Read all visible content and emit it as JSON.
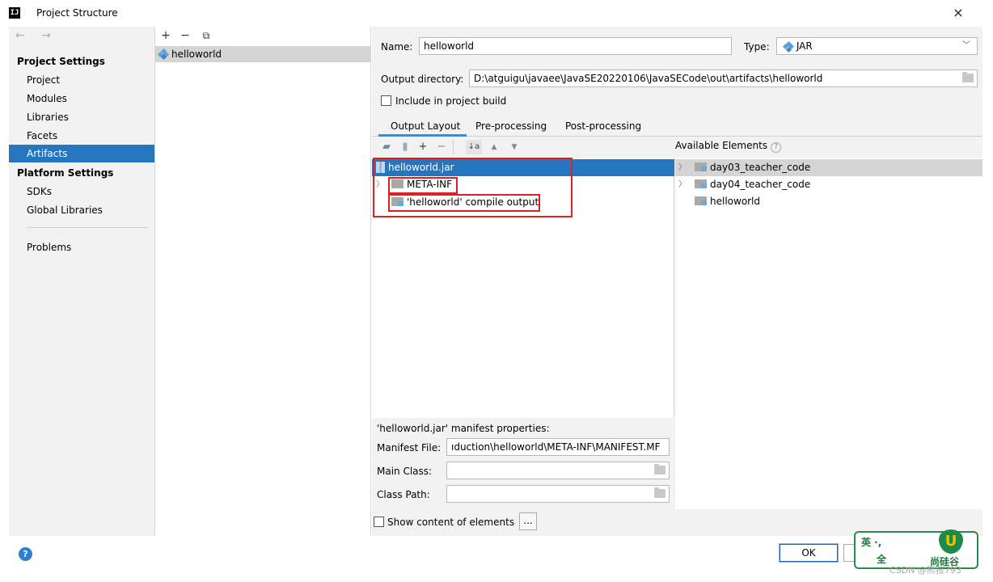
{
  "window": {
    "title": "Project Structure",
    "close": "×"
  },
  "nav": {
    "arrows": "← →",
    "project_settings": "Project Settings",
    "project_items": [
      "Project",
      "Modules",
      "Libraries",
      "Facets",
      "Artifacts"
    ],
    "platform_settings": "Platform Settings",
    "platform_items": [
      "SDKs",
      "Global Libraries"
    ],
    "problems": "Problems",
    "selected": "Artifacts"
  },
  "artifacts": {
    "toolbar": {
      "add": "+",
      "remove": "−",
      "copy": "⧉"
    },
    "items": [
      "helloworld"
    ]
  },
  "form": {
    "name_label": "Name:",
    "name_value": "helloworld",
    "type_label": "Type:",
    "type_value": "JAR",
    "output_dir_label": "Output directory:",
    "output_dir_value": "D:\\atguigu\\javaee\\JavaSE20220106\\JavaSECode\\out\\artifacts\\helloworld",
    "include_label": "Include in project build"
  },
  "tabs": [
    "Output Layout",
    "Pre-processing",
    "Post-processing"
  ],
  "layout_tree": {
    "root": "helloworld.jar",
    "children": [
      "META-INF",
      "'helloworld' compile output"
    ]
  },
  "available": {
    "header": "Available Elements",
    "help": "?",
    "items": [
      "day03_teacher_code",
      "day04_teacher_code",
      "helloworld"
    ]
  },
  "manifest": {
    "title": "'helloworld.jar' manifest properties:",
    "file_label": "Manifest File:",
    "file_value": "ıduction\\helloworld\\META-INF\\MANIFEST.MF",
    "main_class_label": "Main Class:",
    "main_class_value": "",
    "class_path_label": "Class Path:",
    "class_path_value": ""
  },
  "show_content_label": "Show content of elements",
  "dots": "...",
  "buttons": {
    "ok": "OK",
    "help": "?"
  },
  "watermark": {
    "line1": "英 ·, ",
    "line2": "全",
    "brand": "尚硅谷",
    "csdn": "CSDN @熊孩793"
  },
  "colors": {
    "selection": "#2675bf",
    "highlight_box": "#e02020",
    "panel_bg": "#f2f2f2"
  }
}
